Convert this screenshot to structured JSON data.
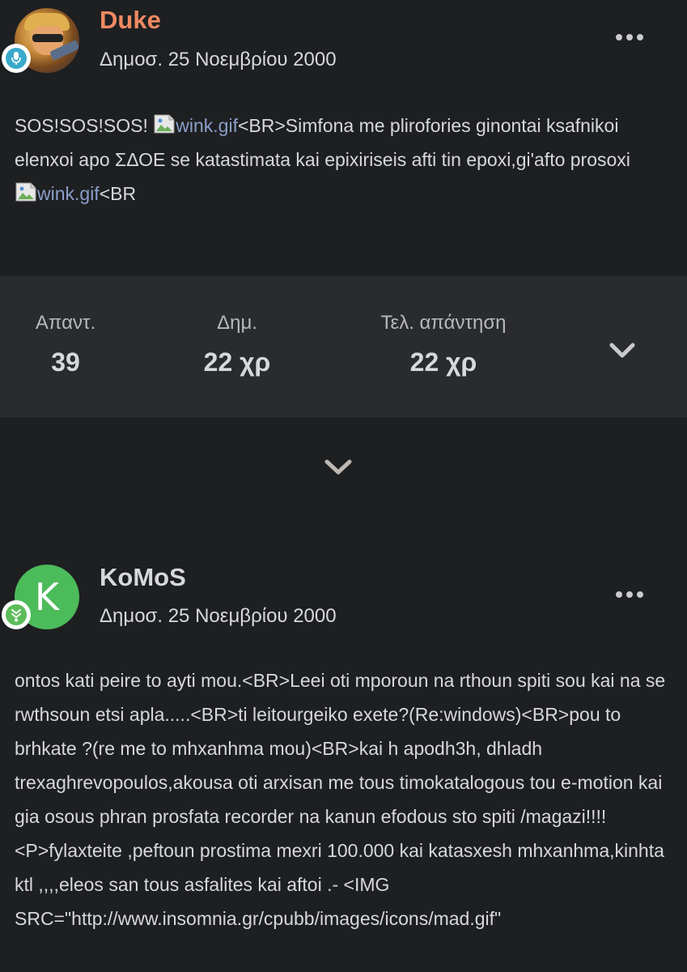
{
  "posts": [
    {
      "author": "Duke",
      "date": "Δημοσ. 25 Νοεμβρίου 2000",
      "content": {
        "part1": "SOS!SOS!SOS! ",
        "img1_alt": "wink.gif",
        "part2": "<BR>Simfona me plirofories ginontai ksafnikoi elenxoi apo ΣΔΟΕ se katastimata kai epixiriseis afti tin epoxi,gi'afto prosoxi ",
        "img2_alt": "wink.gif",
        "part3": "<BR"
      }
    },
    {
      "author": "KoMoS",
      "avatar_letter": "K",
      "date": "Δημοσ. 25 Νοεμβρίου 2000",
      "content": "ontos kati peire to ayti mou.<BR>Leei oti mporoun na rthoun spiti sou kai na se rwthsoun etsi apla.....<BR>ti leitourgeiko exete?(Re:windows)<BR>pou to brhkate ?(re me to mhxanhma mou)<BR>kai h apodh3h, dhladh trexaghrevopoulos,akousa oti arxisan me tous timokatalogous tou e-motion kai gia osous phran prosfata recorder na kanun efodous sto spiti /magazi!!!! <P>fylaxteite ,peftoun prostima mexri 100.000 kai katasxesh mhxanhma,kinhta ktl ,,,,eleos san tous asfalites kai aftoi .- <IMG SRC=\"http://www.insomnia.gr/cpubb/images/icons/mad.gif\""
    }
  ],
  "stats": {
    "replies_label": "Απαντ.",
    "replies_value": "39",
    "created_label": "Δημ.",
    "created_value": "22 χρ",
    "last_reply_label": "Τελ. απάντηση",
    "last_reply_value": "22 χρ"
  },
  "colors": {
    "background": "#1e1f21",
    "stats_bar": "#292b2e",
    "author_highlight": "#f08a63",
    "text": "#d7d8da",
    "link": "#8b9fc8",
    "avatar_green": "#4cbb5a"
  },
  "icons": {
    "menu": "more-horizontal-icon",
    "stats_toggle": "chevron-down-icon",
    "expand": "chevron-down-icon",
    "badge_1": "mic-badge-icon",
    "badge_2": "rank-badge-icon",
    "broken_image": "broken-image-icon"
  }
}
